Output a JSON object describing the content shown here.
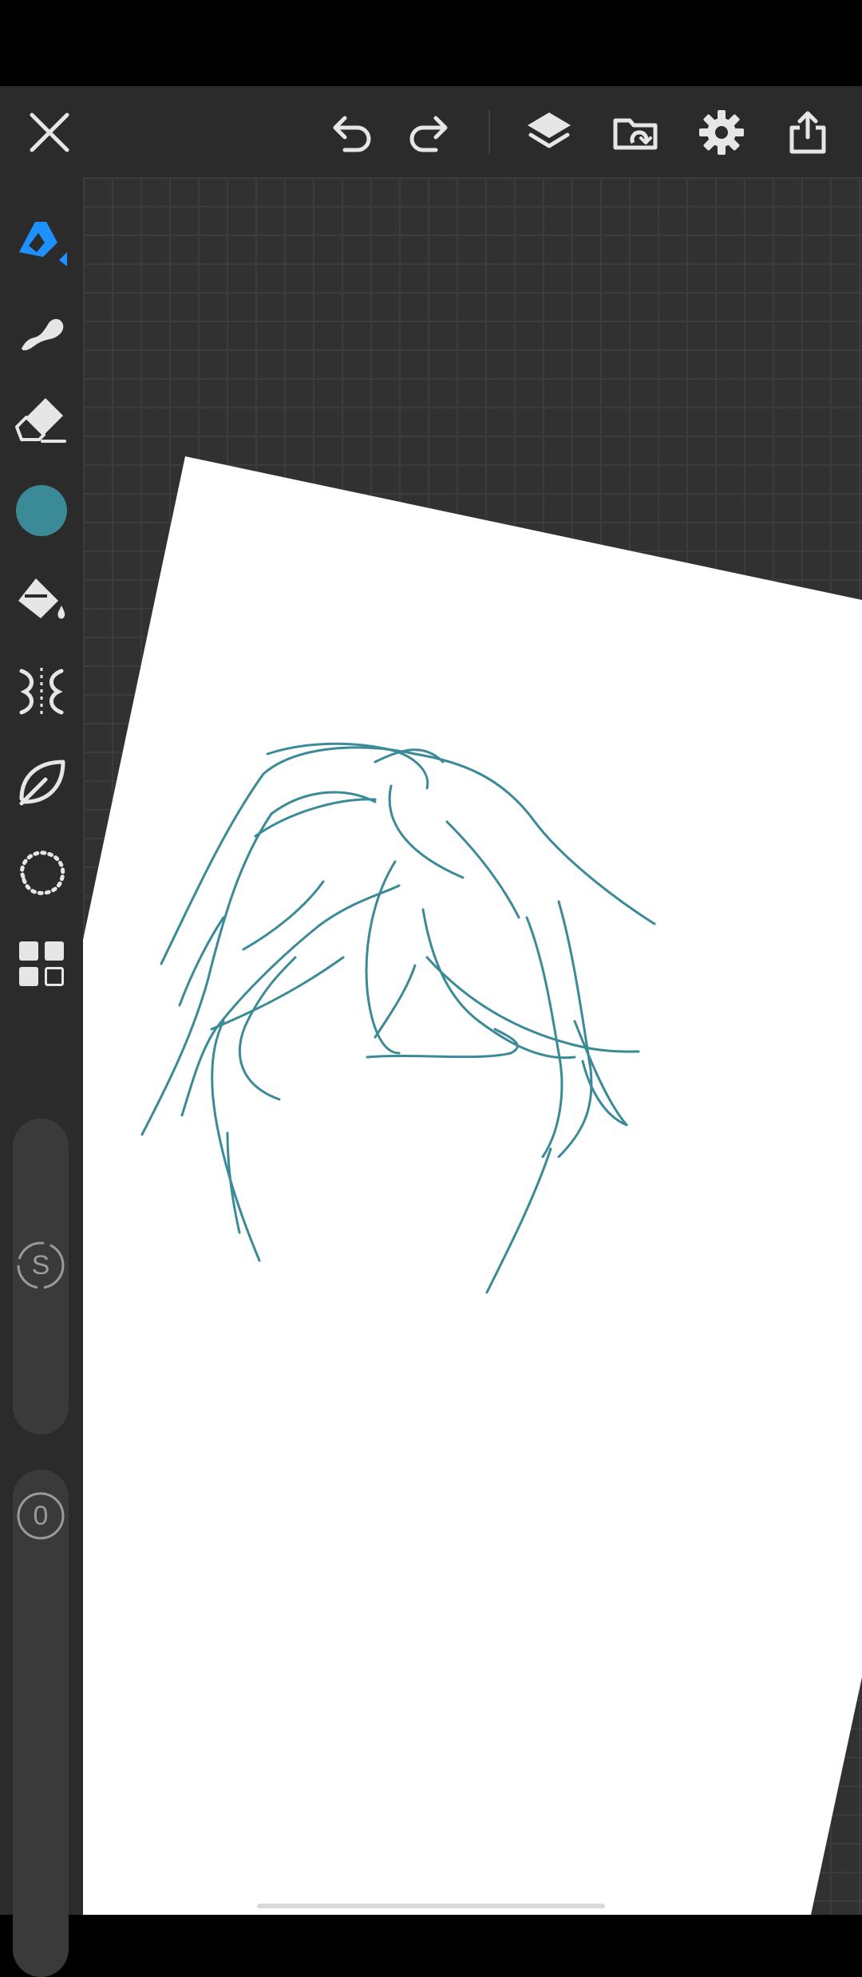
{
  "colors": {
    "toolbar_bg": "#2b2b2b",
    "canvas_bg": "#313131",
    "icon_color": "#e6e6e6",
    "active_tool": "#1e90ff",
    "brush_color": "#3b8a98",
    "paper": "#ffffff"
  },
  "top_toolbar": {
    "icons": [
      "close-icon",
      "undo-icon",
      "redo-icon",
      "layers-icon",
      "gallery-icon",
      "gear-icon",
      "share-icon"
    ]
  },
  "left_toolbar": {
    "tools": [
      "pencil-icon",
      "smudge-icon",
      "eraser-icon",
      "color-swatch",
      "fill-icon",
      "symmetry-icon",
      "leaf-icon",
      "lasso-icon",
      "apps-grid-icon"
    ],
    "selected_tool": "pencil-icon",
    "current_color": "#3b8a98"
  },
  "sliders": {
    "size": {
      "label": "S"
    },
    "opacity": {
      "label": "0"
    }
  }
}
